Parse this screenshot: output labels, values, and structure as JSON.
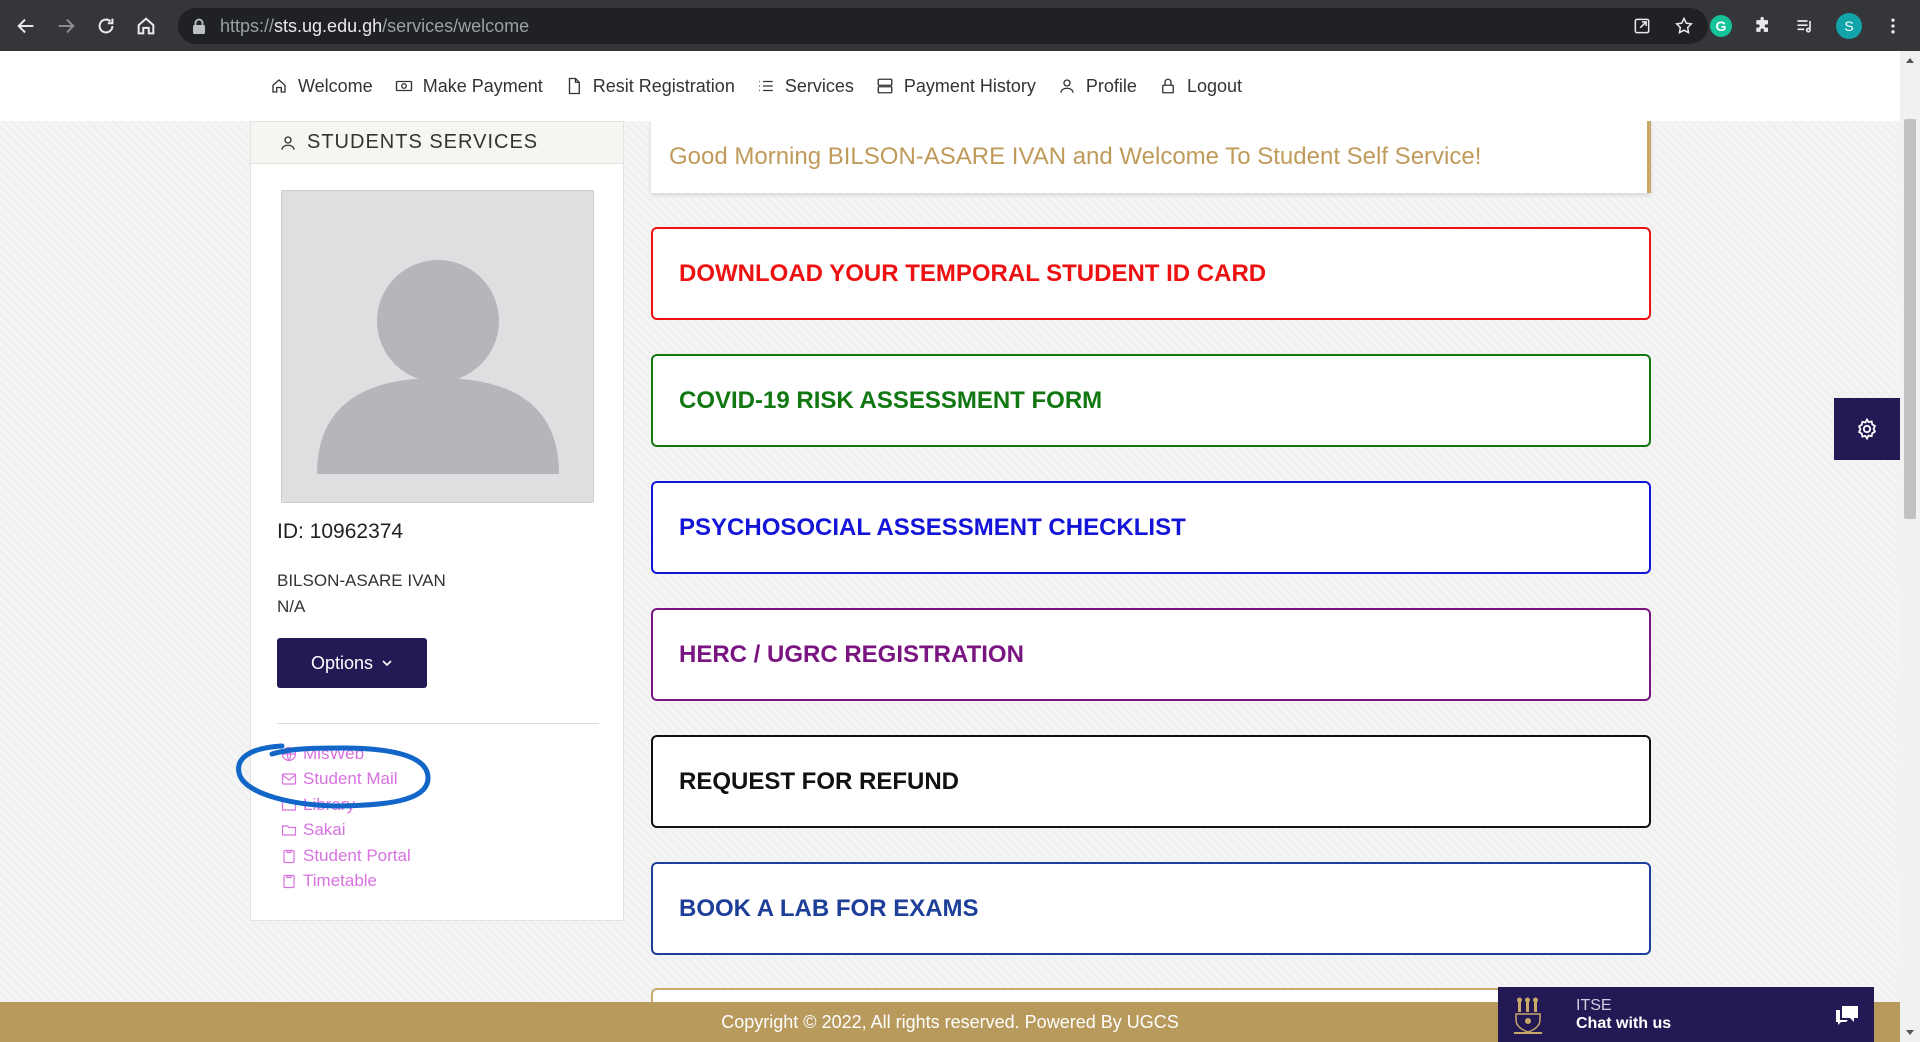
{
  "browser": {
    "url_scheme": "https://",
    "url_host": "sts.ug.edu.gh",
    "url_path": "/services/welcome",
    "grammarly_letter": "G",
    "profile_initial": "S"
  },
  "topnav": {
    "items": [
      {
        "label": "Welcome",
        "icon": "home-icon"
      },
      {
        "label": "Make Payment",
        "icon": "cash-icon"
      },
      {
        "label": "Resit Registration",
        "icon": "file-icon"
      },
      {
        "label": "Services",
        "icon": "list-icon"
      },
      {
        "label": "Payment History",
        "icon": "server-icon"
      },
      {
        "label": "Profile",
        "icon": "user-icon"
      },
      {
        "label": "Logout",
        "icon": "lock-icon"
      }
    ]
  },
  "sidebar": {
    "title": "STUDENTS SERVICES",
    "student_id": "ID: 10962374",
    "student_name": "BILSON-ASARE IVAN",
    "student_program": "N/A",
    "options_label": "Options",
    "links": [
      {
        "label": "MisWeb",
        "icon": "globe-icon"
      },
      {
        "label": "Student Mail",
        "icon": "mail-icon"
      },
      {
        "label": "Library",
        "icon": "folder-icon"
      },
      {
        "label": "Sakai",
        "icon": "folder-icon"
      },
      {
        "label": "Student Portal",
        "icon": "clipboard-icon"
      },
      {
        "label": "Timetable",
        "icon": "clipboard-icon"
      }
    ]
  },
  "main": {
    "welcome": "Good Morning BILSON-ASARE IVAN and Welcome To Student Self Service!",
    "cards": [
      {
        "label": "DOWNLOAD YOUR TEMPORAL STUDENT ID CARD",
        "color": "#ee1111"
      },
      {
        "label": "COVID-19 RISK ASSESSMENT FORM",
        "color": "#117711"
      },
      {
        "label": "PSYCHOSOCIAL ASSESSMENT CHECKLIST",
        "color": "#1414d8"
      },
      {
        "label": "HERC / UGRC REGISTRATION",
        "color": "#7a1480"
      },
      {
        "label": "REQUEST FOR REFUND",
        "color": "#111111"
      },
      {
        "label": "BOOK A LAB FOR EXAMS",
        "color": "#1e3f99"
      }
    ],
    "partial_card_color": "#c9a96a"
  },
  "footer": {
    "text": "Copyright © 2022, All rights reserved. Powered By UGCS"
  },
  "chat": {
    "title": "ITSE",
    "subtitle": "Chat with us"
  },
  "colors": {
    "brand_purple": "#231a55",
    "gold": "#b79a5c",
    "link_pink": "#d772e0",
    "annotation_blue": "#1266c8"
  }
}
